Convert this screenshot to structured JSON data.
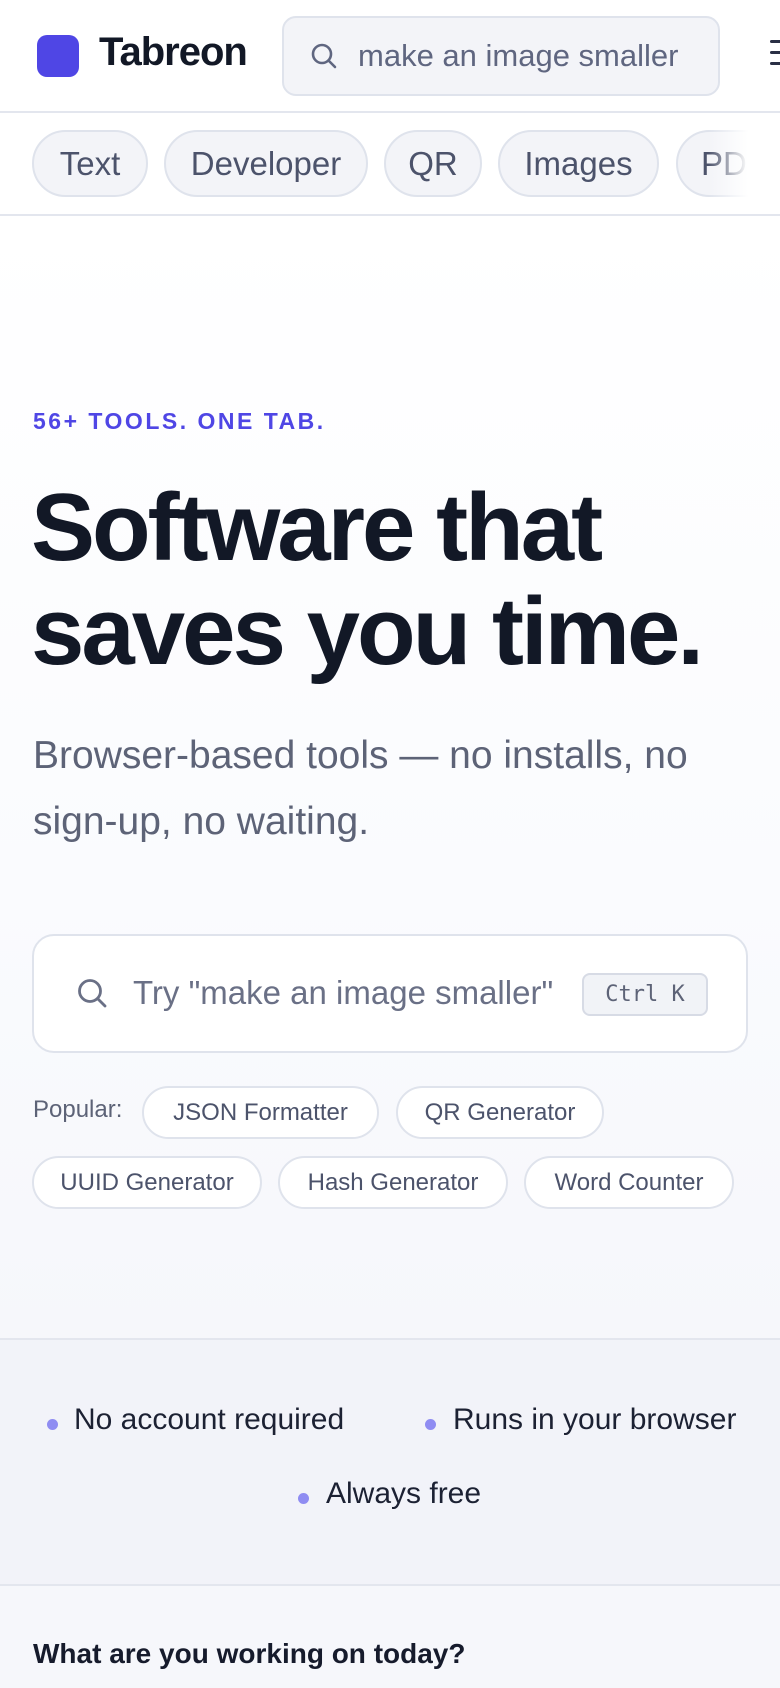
{
  "brand": {
    "name": "Tabreon",
    "color": "#4f46e5"
  },
  "header": {
    "search_value": "make an image smaller",
    "search_icon": "search-icon",
    "menu_icon": "menu-icon"
  },
  "categories": [
    "Text",
    "Developer",
    "QR",
    "Images",
    "PDF"
  ],
  "hero": {
    "eyebrow": "56+ TOOLS. ONE TAB.",
    "headline_line1": "Software that",
    "headline_line2": "saves you time.",
    "subtitle": "Browser-based tools — no installs, no sign-up, no waiting.",
    "search_placeholder": "Try \"make an image smaller\"",
    "shortcut": "Ctrl K",
    "popular_label": "Popular:",
    "popular": [
      "JSON Formatter",
      "QR Generator",
      "UUID Generator",
      "Hash Generator",
      "Word Counter"
    ]
  },
  "features": [
    "No account required",
    "Runs in your browser",
    "Always free"
  ],
  "bottom": {
    "title": "What are you working on today?"
  }
}
